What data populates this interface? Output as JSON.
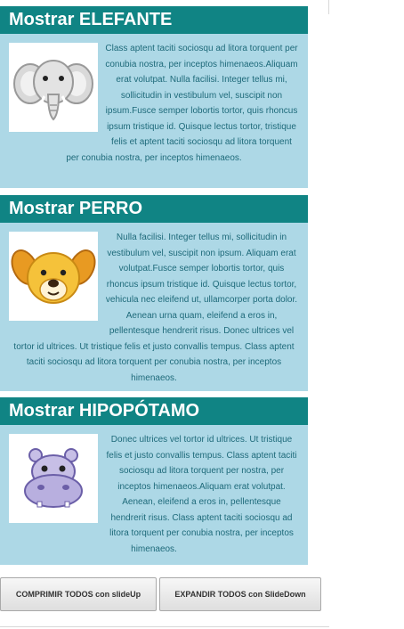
{
  "panels": [
    {
      "title": "Mostrar ELEFANTE",
      "icon": "elephant-icon",
      "text": "Class aptent taciti sociosqu ad litora torquent per conubia nostra, per inceptos himenaeos.Aliquam erat volutpat. Nulla facilisi. Integer tellus mi, sollicitudin in vestibulum vel, suscipit non ipsum.Fusce semper lobortis tortor, quis rhoncus ipsum tristique id. Quisque lectus tortor, tristique felis et aptent taciti sociosqu ad litora torquent per conubia nostra, per inceptos himenaeos."
    },
    {
      "title": "Mostrar PERRO",
      "icon": "dog-icon",
      "text": "Nulla facilisi. Integer tellus mi, sollicitudin in vestibulum vel, suscipit non ipsum. Aliquam erat volutpat.Fusce semper lobortis tortor, quis rhoncus ipsum tristique id. Quisque lectus tortor, vehicula nec eleifend ut, ullamcorper porta dolor. Aenean urna quam, eleifend a eros in, pellentesque hendrerit risus. Donec ultrices vel tortor id ultrices. Ut tristique felis et justo convallis tempus. Class aptent taciti sociosqu ad litora torquent per conubia nostra, per inceptos himenaeos."
    },
    {
      "title": "Mostrar HIPOPÓTAMO",
      "icon": "hippo-icon",
      "text": "Donec ultrices vel tortor id ultrices. Ut tristique felis et justo convallis tempus. Class aptent taciti sociosqu ad litora torquent per nostra, per inceptos himenaeos.Aliquam erat volutpat. Aenean, eleifend a eros in, pellentesque hendrerit risus. Class aptent taciti sociosqu ad litora torquent per conubia nostra, per inceptos himenaeos."
    }
  ],
  "buttons": {
    "collapse_all": "COMPRIMIR TODOS con slideUp",
    "expand_all": "EXPANDIR TODOS con SlideDown"
  },
  "colors": {
    "header_bg": "#108484",
    "body_bg": "#add8e6",
    "body_text": "#1e6a7a"
  }
}
